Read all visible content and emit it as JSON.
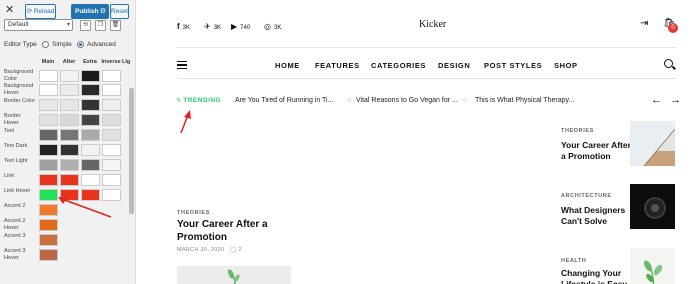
{
  "panel": {
    "close_label": "✕",
    "reload_label": "⟳ Reload",
    "publish_label": "Publish",
    "reset_label": "Reset",
    "scheme_value": "Default",
    "editor_type_label": "Editor Type",
    "editor_options": [
      "Simple",
      "Advanced"
    ],
    "editor_selected": "Advanced",
    "columns": [
      "Main",
      "Alter",
      "Extra",
      "Inverse",
      "Lig"
    ],
    "rows": [
      {
        "label": "Background Color",
        "colors": [
          "#ffffff",
          "#f2f2f2",
          "#1b1b1b",
          "#ffffff"
        ]
      },
      {
        "label": "Background Hover",
        "colors": [
          "#ffffff",
          "#ececec",
          "#2a2a2a",
          "#ffffff"
        ]
      },
      {
        "label": "Border Color",
        "colors": [
          "#e8e8e8",
          "#e6e6e6",
          "#333333",
          "#eeeeee"
        ]
      },
      {
        "label": "Border Hover",
        "colors": [
          "#e2e2e2",
          "#d8d8d8",
          "#444444",
          "#dddddd"
        ]
      },
      {
        "label": "Text",
        "colors": [
          "#666666",
          "#777777",
          "#aaaaaa",
          "#e0e0e0"
        ]
      },
      {
        "label": "Text Dark",
        "colors": [
          "#222222",
          "#333333",
          "#f2f2f2",
          "#ffffff"
        ]
      },
      {
        "label": "Text Light",
        "colors": [
          "#a0a0a0",
          "#b0b0b0",
          "#666666",
          "#f5f5f5"
        ]
      },
      {
        "label": "Link",
        "colors": [
          "#e8341c",
          "#e8341c",
          "#ffffff",
          "#ffffff"
        ]
      },
      {
        "label": "Link Hover",
        "colors": [
          "#22e058",
          "#e8341c",
          "#e8341c",
          "#ffffff"
        ]
      },
      {
        "label": "Accent 2",
        "colors": [
          "#f07a2a"
        ]
      },
      {
        "label": "Accent 2 Hover",
        "colors": [
          "#e06a1a"
        ]
      },
      {
        "label": "Accent 3",
        "colors": [
          "#c9703e"
        ]
      },
      {
        "label": "Accent 3 Hover",
        "colors": [
          "#b86a48"
        ]
      }
    ]
  },
  "site": {
    "social": [
      {
        "icon": "facebook-icon",
        "glyph": "f",
        "count": "3K"
      },
      {
        "icon": "twitter-icon",
        "glyph": "🐦",
        "count": "3K"
      },
      {
        "icon": "youtube-icon",
        "glyph": "▶",
        "count": "740"
      },
      {
        "icon": "instagram-icon",
        "glyph": "◎",
        "count": "3K"
      }
    ],
    "logo": "Kicker",
    "cart_count": "0",
    "nav": [
      "HOME",
      "FEATURES",
      "CATEGORIES",
      "DESIGN",
      "POST STYLES",
      "SHOP"
    ],
    "trending_label": "TRENDING",
    "trending_items": [
      "Are You Tired of Running in Ti...",
      "Vital Reasons to Go Vegan for ...",
      "This is What Physical Therapy..."
    ],
    "main_post": {
      "category": "THEORIES",
      "title": "Your Career After a Promotion",
      "date": "MARCH 30, 2020",
      "comments": "2"
    },
    "side_posts": [
      {
        "category": "THEORIES",
        "title": "Your Career After a Promotion"
      },
      {
        "category": "ARCHITECTURE",
        "title": "What Designers Can't Solve"
      },
      {
        "category": "HEALTH",
        "title": "Changing Your Lifestyle is Easy"
      }
    ]
  },
  "colors": {
    "accent_green": "#2ecc71",
    "wp_blue": "#2271b1",
    "annotation_red": "#e02424"
  }
}
